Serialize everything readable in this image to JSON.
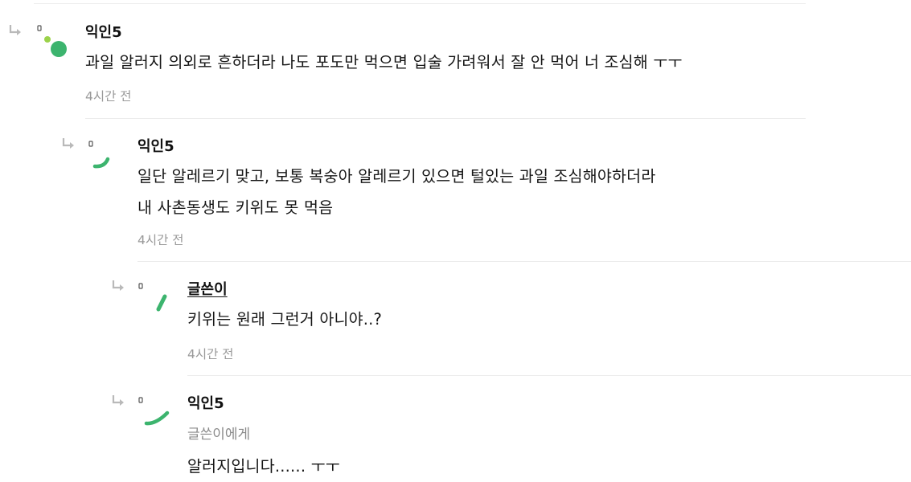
{
  "comments": [
    {
      "author": "익인5",
      "lines": [
        "과일 알러지 의외로 흔하더라 나도 포도만 먹으면 입술 가려워서 잘 안 먹어 너 조심해 ㅜㅜ"
      ],
      "time": "4시간 전"
    },
    {
      "author": "익인5",
      "lines": [
        "일단 알레르기 맞고, 보통 복숭아 알레르기 있으면 털있는 과일 조심해야하더라",
        "내 사촌동생도 키위도 못 먹음"
      ],
      "time": "4시간 전"
    },
    {
      "author": "글쓴이",
      "lines": [
        "키위는 원래 그런거 아니야..?"
      ],
      "time": "4시간 전"
    },
    {
      "author": "익인5",
      "mention": "글쓴이에게",
      "lines": [
        "알러지입니다...... ㅜㅜ"
      ]
    }
  ],
  "colors": {
    "avatar_green": "#3cb46e",
    "avatar_light": "#9bd24a",
    "reply_arrow": "#b9b9b9"
  },
  "icons": {
    "reply": "reply-arrow-icon",
    "avatar": "avatar-icon"
  }
}
